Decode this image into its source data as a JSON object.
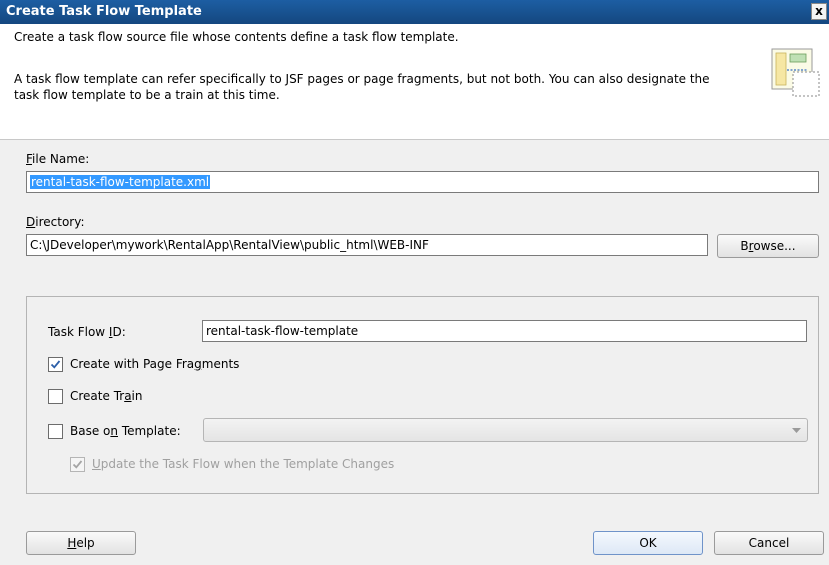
{
  "window": {
    "title": "Create Task Flow Template",
    "close_label": "x"
  },
  "header": {
    "line1": "Create a task flow source file whose contents define a task flow template.",
    "line2": "A task flow template can refer specifically to JSF pages or page fragments, but not both.  You can also designate the task flow template to be a train at this time.",
    "icon": "task-flow-template-icon"
  },
  "file_name": {
    "label_first": "F",
    "label_rest": "ile Name:",
    "value": "rental-task-flow-template.xml"
  },
  "directory": {
    "label_first": "D",
    "label_rest": "irectory:",
    "value": "C:\\JDeveloper\\mywork\\RentalApp\\RentalView\\public_html\\WEB-INF",
    "browse_pre": "B",
    "browse_u": "r",
    "browse_post": "owse..."
  },
  "task_flow_id": {
    "label_pre": "Task Flow ",
    "label_u": "I",
    "label_post": "D:",
    "value": "rental-task-flow-template"
  },
  "options": {
    "page_fragments": {
      "pre": "Create with Page Fra",
      "u": "g",
      "post": "ments",
      "checked": true
    },
    "create_train": {
      "pre": "Create Tr",
      "u": "a",
      "post": "in",
      "checked": false
    },
    "base_on_template": {
      "pre": "Base o",
      "u": "n",
      "post": " Template:",
      "checked": false,
      "selected_value": ""
    },
    "update_on_change": {
      "u": "U",
      "post": "pdate the Task Flow when the Template Changes",
      "checked": true,
      "enabled": false
    }
  },
  "buttons": {
    "help_u": "H",
    "help_post": "elp",
    "ok": "OK",
    "cancel": "Cancel"
  },
  "colors": {
    "titlebar": "#1b5a9c",
    "selection": "#3399ff",
    "checkmark": "#2d5fa8"
  }
}
